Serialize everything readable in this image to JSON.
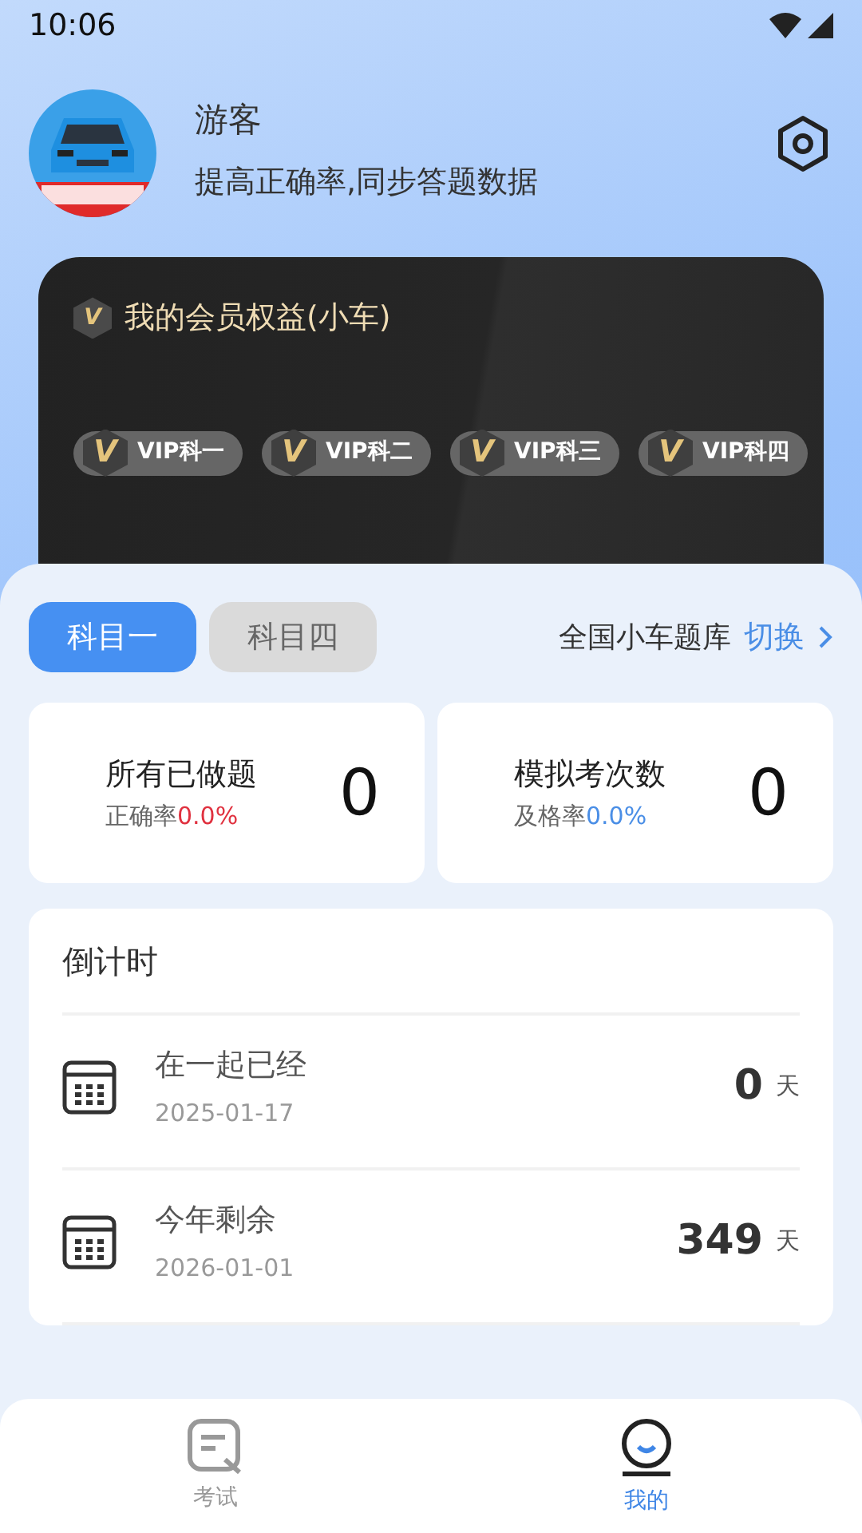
{
  "status_bar": {
    "time": "10:06"
  },
  "profile": {
    "name": "游客",
    "subtitle": "提高正确率,同步答题数据"
  },
  "vip_card": {
    "badge": "V",
    "title": "我的会员权益(小车)",
    "chips": [
      {
        "badge": "V",
        "label": "VIP科一"
      },
      {
        "badge": "V",
        "label": "VIP科二"
      },
      {
        "badge": "V",
        "label": "VIP科三"
      },
      {
        "badge": "V",
        "label": "VIP科四"
      }
    ]
  },
  "subject_tabs": [
    {
      "label": "科目一",
      "selected": true
    },
    {
      "label": "科目四",
      "selected": false
    }
  ],
  "question_bank": {
    "label": "全国小车题库",
    "action": "切换"
  },
  "stats": [
    {
      "title": "所有已做题",
      "rate_label": "正确率",
      "rate": "0.0%",
      "color": "#e0313f",
      "value": "0"
    },
    {
      "title": "模拟考次数",
      "rate_label": "及格率",
      "rate": "0.0%",
      "color": "#4a8ee6",
      "value": "0"
    }
  ],
  "countdown": {
    "title": "倒计时",
    "items": [
      {
        "label": "在一起已经",
        "date": "2025-01-17",
        "days": "0",
        "unit": "天"
      },
      {
        "label": "今年剩余",
        "date": "2026-01-01",
        "days": "349",
        "unit": "天"
      }
    ]
  },
  "bottom_nav": [
    {
      "label": "考试",
      "kind": "exam",
      "selected": false
    },
    {
      "label": "我的",
      "kind": "profile",
      "selected": true
    }
  ]
}
